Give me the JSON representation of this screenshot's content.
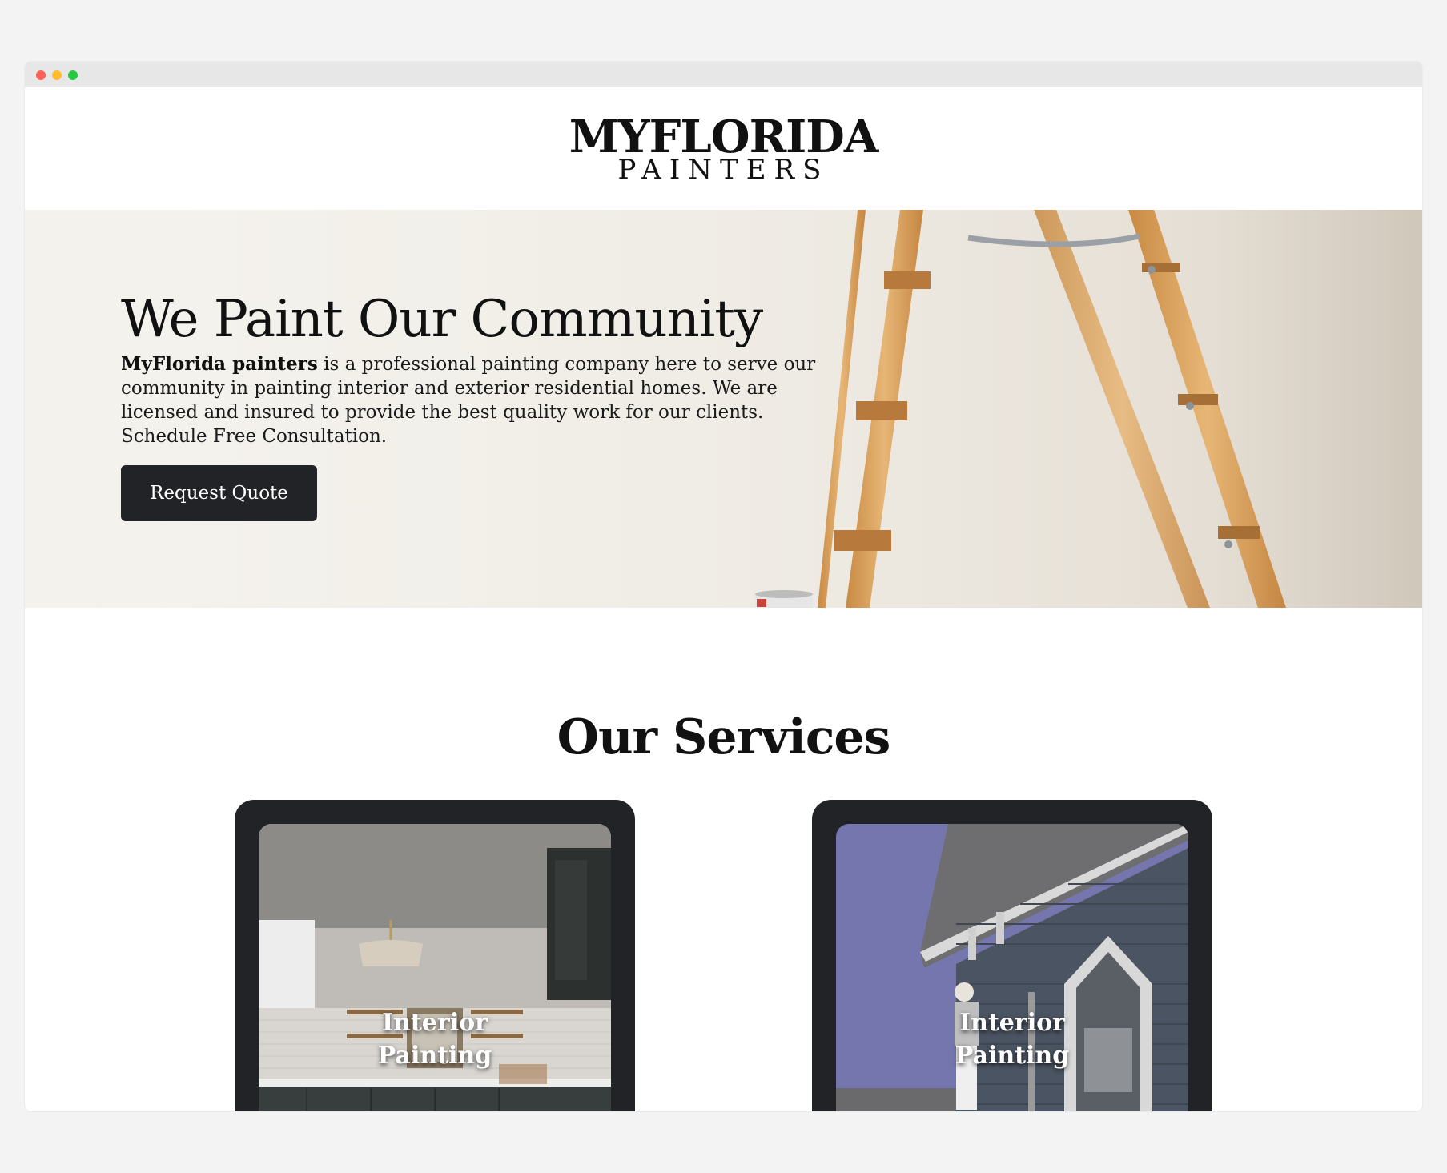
{
  "window": {
    "controls": [
      "close",
      "minimize",
      "maximize"
    ]
  },
  "header": {
    "logo_main": "MYFLORIDA",
    "logo_sub": "PAINTERS"
  },
  "hero": {
    "title": "We Paint Our Community",
    "text_bold": "MyFlorida painters",
    "text_rest": " is a professional painting company here to serve our community in painting interior and exterior residential homes. We are licensed and insured to provide the best quality work for our clients. Schedule Free Consultation.",
    "button_label": "Request Quote"
  },
  "services": {
    "title": "Our Services",
    "cards": [
      {
        "label": "Interior Painting",
        "image": "kitchen-photo"
      },
      {
        "label": "Interior Painting",
        "image": "house-exterior-photo"
      }
    ]
  },
  "colors": {
    "dark": "#222326",
    "page_bg": "#f3f3f3",
    "hero_bg": "#efece5",
    "ladder_wood": "#d9a45f",
    "sky_purple": "#7576ad"
  }
}
